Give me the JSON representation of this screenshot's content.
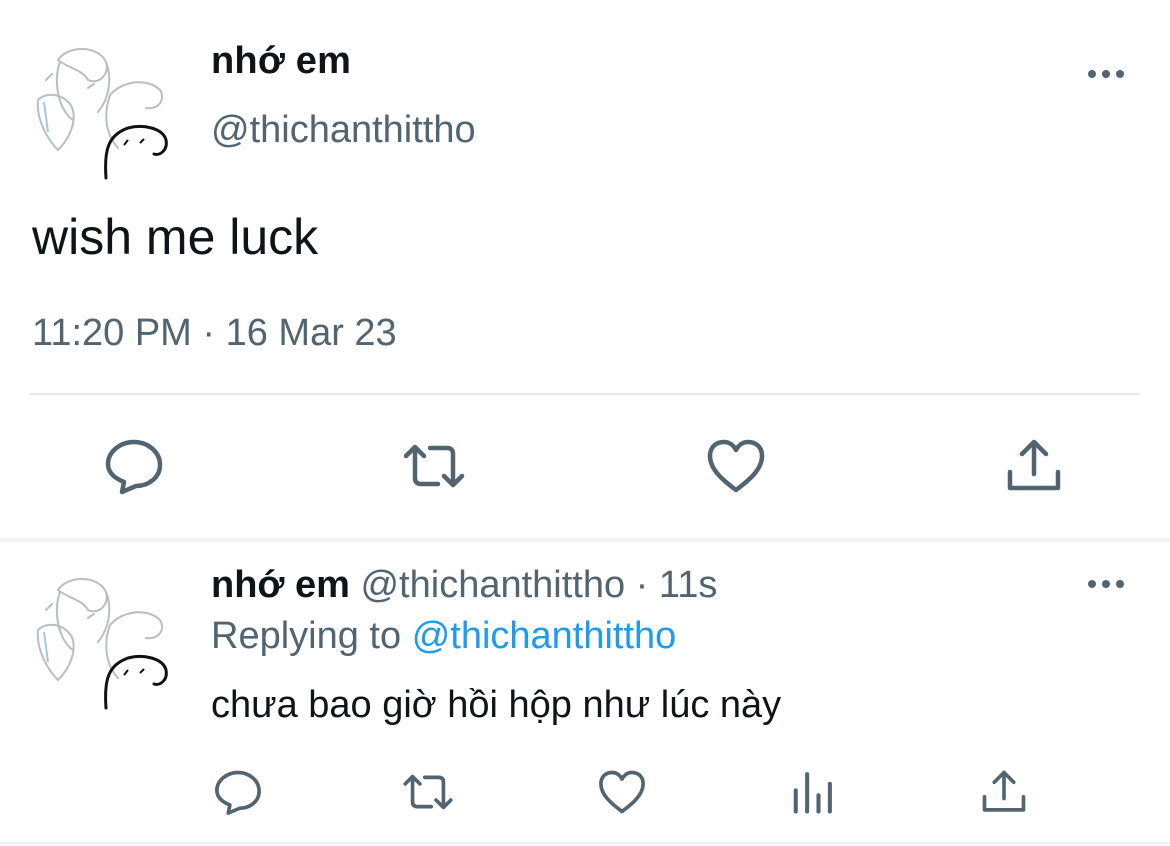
{
  "tweet": {
    "display_name": "nhớ em",
    "handle": "@thichanthittho",
    "text": "wish me luck",
    "timestamp": "11:20 PM · 16 Mar 23",
    "more_icon": "more-horizontal-icon",
    "actions": [
      "reply-icon",
      "retweet-icon",
      "like-icon",
      "share-icon"
    ]
  },
  "reply": {
    "display_name": "nhớ em",
    "handle": "@thichanthittho",
    "separator": " · ",
    "time_ago": "11s",
    "replying_to_label": "Replying to",
    "replying_to_handle": "@thichanthittho",
    "text": "chưa bao giờ hồi hộp như lúc này",
    "more_icon": "more-horizontal-icon",
    "actions": [
      "reply-icon",
      "retweet-icon",
      "like-icon",
      "analytics-icon",
      "share-icon"
    ]
  },
  "colors": {
    "text_primary": "#0f1419",
    "text_secondary": "#536471",
    "link": "#1d9bf0",
    "divider": "#e7e9ea"
  }
}
